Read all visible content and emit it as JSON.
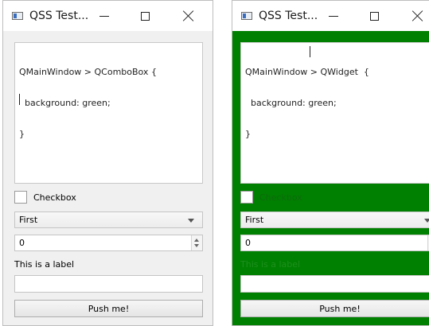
{
  "windows": [
    {
      "title": "QSS Test...",
      "editor_lines": [
        "QMainWindow > QComboBox {",
        "  background: green;",
        "}"
      ],
      "checkbox_label": "Checkbox",
      "combo_value": "First",
      "spin_value": "0",
      "label_text": "This is a label",
      "lineedit_value": "",
      "button_label": "Push me!"
    },
    {
      "title": "QSS Test...",
      "editor_lines": [
        "QMainWindow > QWidget  {",
        "  background: green;",
        "}"
      ],
      "checkbox_label": "Checkbox",
      "combo_value": "First",
      "spin_value": "0",
      "label_text": "This is a label",
      "lineedit_value": "",
      "button_label": "Push me!"
    }
  ],
  "colors": {
    "accent_green": "#008000",
    "window_bg": "#f0f0f0",
    "titlebar_bg": "#ffffff"
  },
  "icons": [
    "app-window-icon",
    "minimize-icon",
    "maximize-icon",
    "close-icon",
    "dropdown-arrow-icon",
    "spin-up-icon",
    "spin-down-icon"
  ]
}
